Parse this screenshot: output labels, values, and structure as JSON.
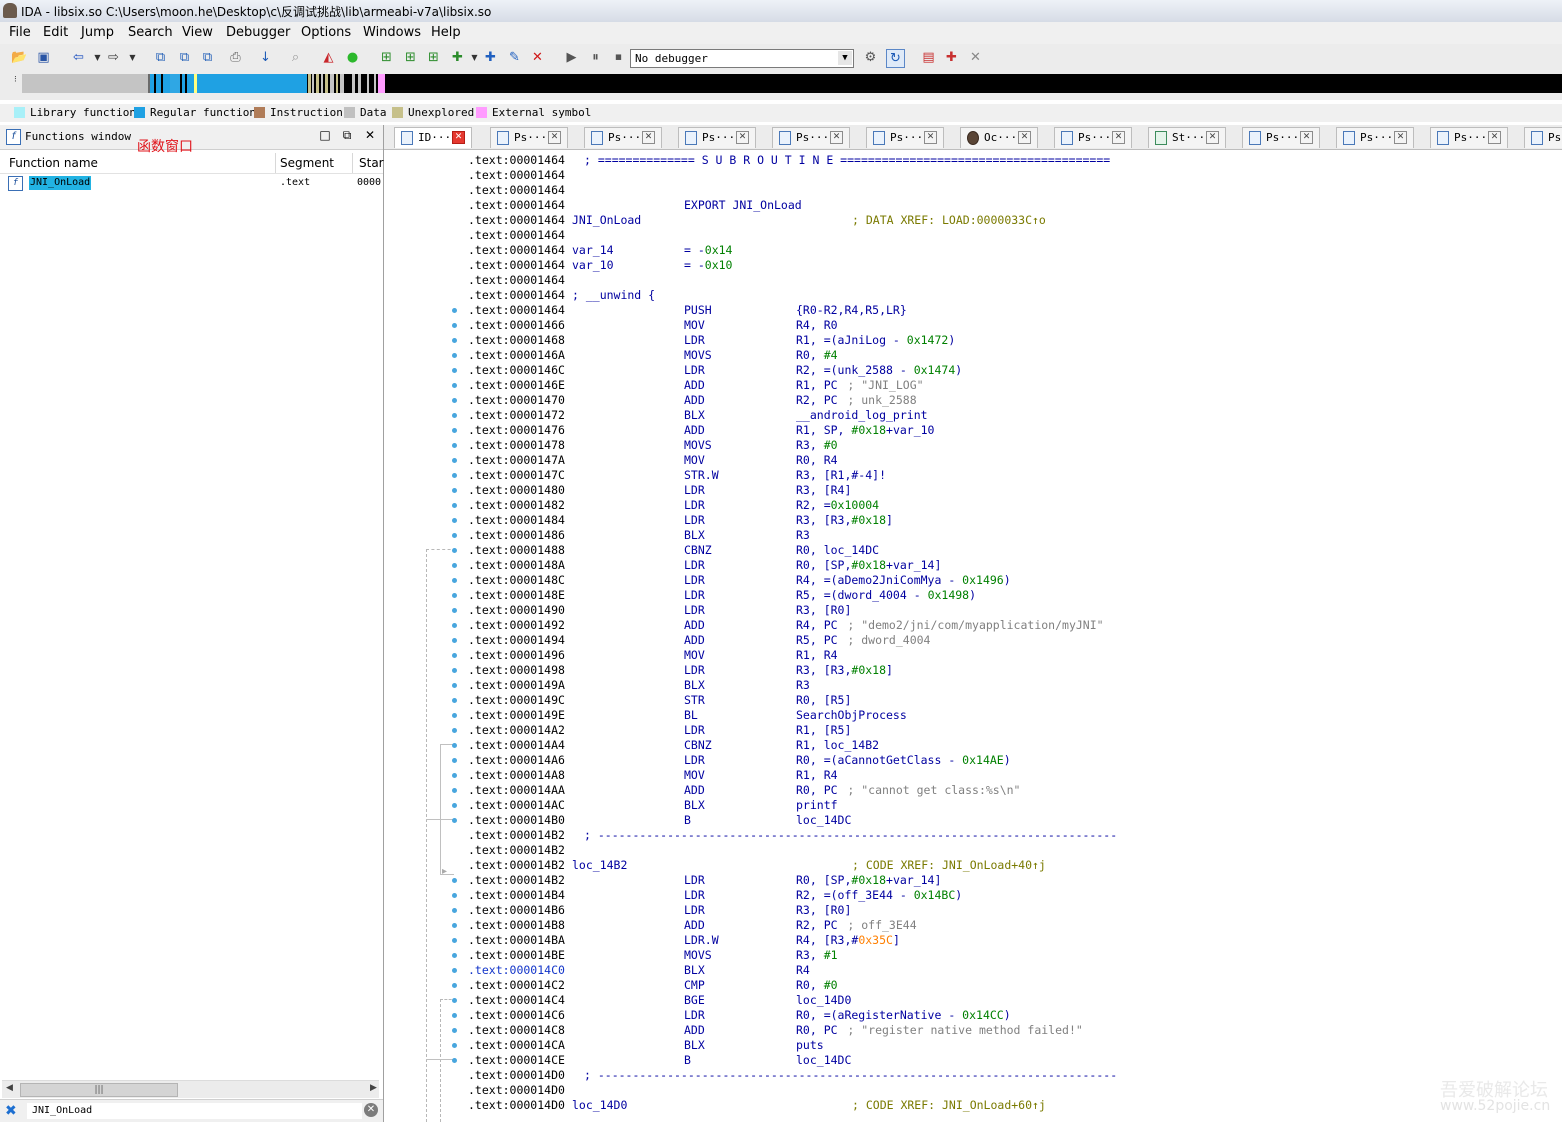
{
  "window": {
    "title": "IDA - libsix.so C:\\Users\\moon.he\\Desktop\\c\\反调试挑战\\lib\\armeabi-v7a\\libsix.so"
  },
  "menu": [
    "File",
    "Edit",
    "Jump",
    "Search",
    "View",
    "Debugger",
    "Options",
    "Windows",
    "Help"
  ],
  "toolbar": {
    "debugger_select": "No debugger"
  },
  "legend": [
    {
      "label": "Library function",
      "color": "#a8f0f8"
    },
    {
      "label": "Regular function",
      "color": "#1fa1e3"
    },
    {
      "label": "Instruction",
      "color": "#b07c58"
    },
    {
      "label": "Data",
      "color": "#c0c0c0"
    },
    {
      "label": "Unexplored",
      "color": "#c6c08a"
    },
    {
      "label": "External symbol",
      "color": "#ff9bff"
    }
  ],
  "functions_window": {
    "title": "Functions window",
    "annotation": "函数窗口",
    "columns": [
      "Function name",
      "Segment",
      "Star"
    ],
    "rows": [
      {
        "name": "JNI_OnLoad",
        "segment": ".text",
        "start": "0000"
      }
    ],
    "filter_value": "JNI_OnLoad"
  },
  "tabs": [
    "ID···",
    "Ps···",
    "Ps···",
    "Ps···",
    "Ps···",
    "Ps···",
    "Oc···",
    "Ps···",
    "St···",
    "Ps···",
    "Ps···",
    "Ps···",
    "Ps"
  ],
  "disasm": [
    {
      "addr": ".text:00001464",
      "sub": "; ============== S U B R O U T I N E ======================================="
    },
    {
      "addr": ".text:00001464"
    },
    {
      "addr": ".text:00001464"
    },
    {
      "addr": ".text:00001464",
      "mn": "EXPORT JNI_OnLoad"
    },
    {
      "addr": ".text:00001464",
      "lbl": "JNI_OnLoad",
      "cmw": "; DATA XREF: LOAD:0000033C↑o"
    },
    {
      "addr": ".text:00001464"
    },
    {
      "addr": ".text:00001464",
      "lbl": "var_14",
      "mn": "= -0x14"
    },
    {
      "addr": ".text:00001464",
      "lbl": "var_10",
      "mn": "= -0x10"
    },
    {
      "addr": ".text:00001464"
    },
    {
      "addr": ".text:00001464",
      "lbl": "; __unwind {"
    },
    {
      "addr": ".text:00001464",
      "mn": "PUSH",
      "op": "{R0-R2,R4,R5,LR}"
    },
    {
      "addr": ".text:00001466",
      "mn": "MOV",
      "op": "R4, R0"
    },
    {
      "addr": ".text:00001468",
      "mn": "LDR",
      "op": "R1, =(aJniLog - 0x1472)"
    },
    {
      "addr": ".text:0000146A",
      "mn": "MOVS",
      "op": "R0, #4"
    },
    {
      "addr": ".text:0000146C",
      "mn": "LDR",
      "op": "R2, =(unk_2588 - 0x1474)"
    },
    {
      "addr": ".text:0000146E",
      "mn": "ADD",
      "op": "R1, PC",
      "cm": "; \"JNI_LOG\""
    },
    {
      "addr": ".text:00001470",
      "mn": "ADD",
      "op": "R2, PC",
      "cm": "; unk_2588"
    },
    {
      "addr": ".text:00001472",
      "mn": "BLX",
      "op": "__android_log_print"
    },
    {
      "addr": ".text:00001476",
      "mn": "ADD",
      "op": "R1, SP, #0x18+var_10"
    },
    {
      "addr": ".text:00001478",
      "mn": "MOVS",
      "op": "R3, #0"
    },
    {
      "addr": ".text:0000147A",
      "mn": "MOV",
      "op": "R0, R4"
    },
    {
      "addr": ".text:0000147C",
      "mn": "STR.W",
      "op": "R3, [R1,#-4]!"
    },
    {
      "addr": ".text:00001480",
      "mn": "LDR",
      "op": "R3, [R4]"
    },
    {
      "addr": ".text:00001482",
      "mn": "LDR",
      "op": "R2, =0x10004"
    },
    {
      "addr": ".text:00001484",
      "mn": "LDR",
      "op": "R3, [R3,#0x18]"
    },
    {
      "addr": ".text:00001486",
      "mn": "BLX",
      "op": "R3"
    },
    {
      "addr": ".text:00001488",
      "mn": "CBNZ",
      "op": "R0, loc_14DC"
    },
    {
      "addr": ".text:0000148A",
      "mn": "LDR",
      "op": "R0, [SP,#0x18+var_14]"
    },
    {
      "addr": ".text:0000148C",
      "mn": "LDR",
      "op": "R4, =(aDemo2JniComMya - 0x1496)"
    },
    {
      "addr": ".text:0000148E",
      "mn": "LDR",
      "op": "R5, =(dword_4004 - 0x1498)"
    },
    {
      "addr": ".text:00001490",
      "mn": "LDR",
      "op": "R3, [R0]"
    },
    {
      "addr": ".text:00001492",
      "mn": "ADD",
      "op": "R4, PC",
      "cm": "; \"demo2/jni/com/myapplication/myJNI\""
    },
    {
      "addr": ".text:00001494",
      "mn": "ADD",
      "op": "R5, PC",
      "cm": "; dword_4004"
    },
    {
      "addr": ".text:00001496",
      "mn": "MOV",
      "op": "R1, R4"
    },
    {
      "addr": ".text:00001498",
      "mn": "LDR",
      "op": "R3, [R3,#0x18]"
    },
    {
      "addr": ".text:0000149A",
      "mn": "BLX",
      "op": "R3"
    },
    {
      "addr": ".text:0000149C",
      "mn": "STR",
      "op": "R0, [R5]"
    },
    {
      "addr": ".text:0000149E",
      "mn": "BL",
      "op": "SearchObjProcess"
    },
    {
      "addr": ".text:000014A2",
      "mn": "LDR",
      "op": "R1, [R5]"
    },
    {
      "addr": ".text:000014A4",
      "mn": "CBNZ",
      "op": "R1, loc_14B2"
    },
    {
      "addr": ".text:000014A6",
      "mn": "LDR",
      "op": "R0, =(aCannotGetClass - 0x14AE)"
    },
    {
      "addr": ".text:000014A8",
      "mn": "MOV",
      "op": "R1, R4"
    },
    {
      "addr": ".text:000014AA",
      "mn": "ADD",
      "op": "R0, PC",
      "cm": "; \"cannot get class:%s\\n\""
    },
    {
      "addr": ".text:000014AC",
      "mn": "BLX",
      "op": "printf"
    },
    {
      "addr": ".text:000014B0",
      "mn": "B",
      "op": "loc_14DC"
    },
    {
      "addr": ".text:000014B2",
      "sub": "; ---------------------------------------------------------------------------"
    },
    {
      "addr": ".text:000014B2"
    },
    {
      "addr": ".text:000014B2",
      "lbl": "loc_14B2",
      "cmw": "; CODE XREF: JNI_OnLoad+40↑j"
    },
    {
      "addr": ".text:000014B2",
      "mn": "LDR",
      "op": "R0, [SP,#0x18+var_14]"
    },
    {
      "addr": ".text:000014B4",
      "mn": "LDR",
      "op": "R2, =(off_3E44 - 0x14BC)"
    },
    {
      "addr": ".text:000014B6",
      "mn": "LDR",
      "op": "R3, [R0]"
    },
    {
      "addr": ".text:000014B8",
      "mn": "ADD",
      "op": "R2, PC",
      "cm": "; off_3E44"
    },
    {
      "addr": ".text:000014BA",
      "mn": "LDR.W",
      "op": "R4, [R3,#0x35C]"
    },
    {
      "addr": ".text:000014BE",
      "mn": "MOVS",
      "op": "R3, #1"
    },
    {
      "addr": ".text:000014C0",
      "mn": "BLX",
      "op": "R4",
      "blue": true
    },
    {
      "addr": ".text:000014C2",
      "mn": "CMP",
      "op": "R0, #0"
    },
    {
      "addr": ".text:000014C4",
      "mn": "BGE",
      "op": "loc_14D0"
    },
    {
      "addr": ".text:000014C6",
      "mn": "LDR",
      "op": "R0, =(aRegisterNative - 0x14CC)"
    },
    {
      "addr": ".text:000014C8",
      "mn": "ADD",
      "op": "R0, PC",
      "cm": "; \"register native method failed!\""
    },
    {
      "addr": ".text:000014CA",
      "mn": "BLX",
      "op": "puts"
    },
    {
      "addr": ".text:000014CE",
      "mn": "B",
      "op": "loc_14DC"
    },
    {
      "addr": ".text:000014D0",
      "sub": "; ---------------------------------------------------------------------------"
    },
    {
      "addr": ".text:000014D0"
    },
    {
      "addr": ".text:000014D0",
      "lbl": "loc_14D0",
      "cmw": "; CODE XREF: JNI_OnLoad+60↑j"
    }
  ],
  "watermark": {
    "line1": "吾爱破解论坛",
    "line2": "www.52pojie.cn"
  }
}
